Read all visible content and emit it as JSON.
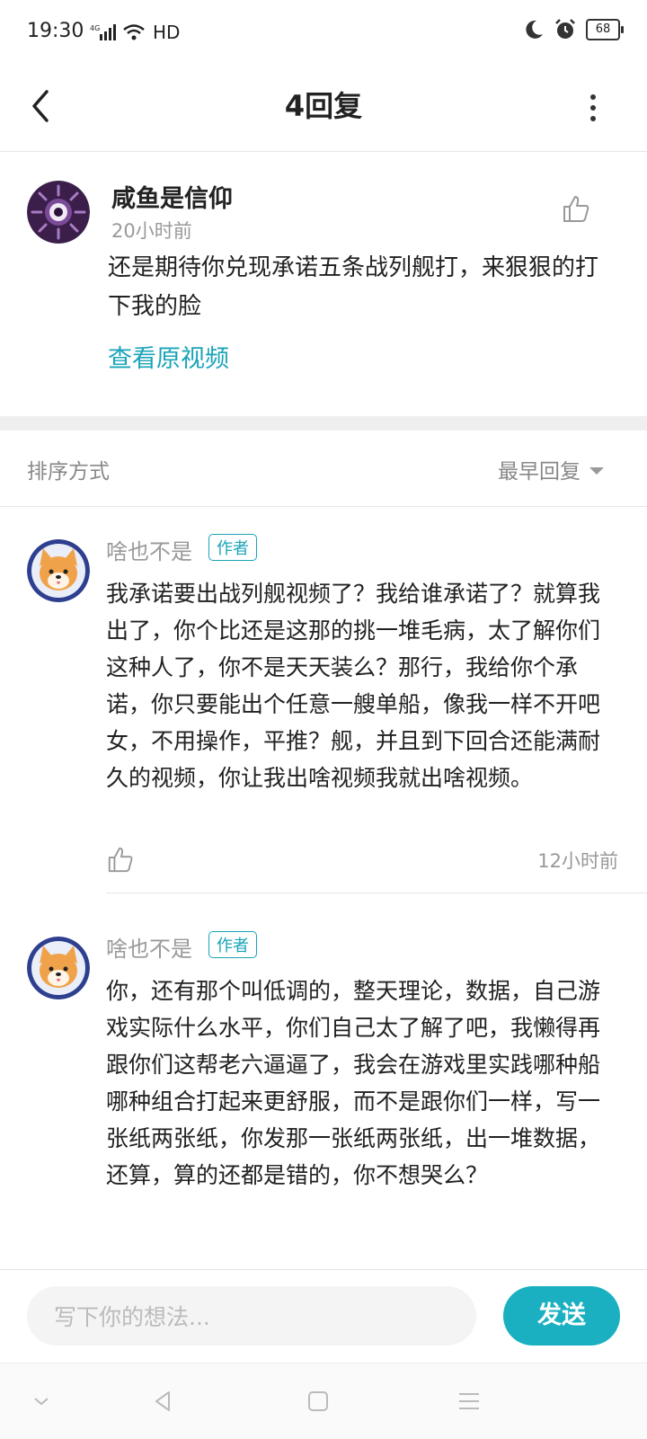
{
  "status_bar": {
    "time": "19:30",
    "network": "4G",
    "hd": "HD",
    "battery": "68",
    "icons": [
      "signal-icon",
      "wifi-icon",
      "moon-icon",
      "alarm-icon",
      "battery-icon"
    ]
  },
  "header": {
    "title": "4回复",
    "back_icon": "back-arrow-icon",
    "more_icon": "more-vertical-icon"
  },
  "post": {
    "author": "咸鱼是信仰",
    "time": "20小时前",
    "text": "还是期待你兑现承诺五条战列舰打，来狠狠的打下我的脸",
    "link": "查看原视频",
    "avatar_icon": "eye-avatar-icon",
    "like_icon": "thumbs-up-icon"
  },
  "sort": {
    "label": "排序方式",
    "value": "最早回复"
  },
  "replies": [
    {
      "author": "啥也不是",
      "badge": "作者",
      "text": "我承诺要出战列舰视频了？我给谁承诺了？就算我出了，你个比还是这那的挑一堆毛病，太了解你们这种人了，你不是天天装么？那行，我给你个承诺，你只要能出个任意一艘单船，像我一样不开吧女，不用操作，平推？舰，并且到下回合还能满耐久的视频，你让我出啥视频我就出啥视频。",
      "time": "12小时前"
    },
    {
      "author": "啥也不是",
      "badge": "作者",
      "text": "你，还有那个叫低调的，整天理论，数据，自己游戏实际什么水平，你们自己太了解了吧，我懒得再跟你们这帮老六逼逼了，我会在游戏里实践哪种船哪种组合打起来更舒服，而不是跟你们一样，写一张纸两张纸，你发那一张纸两张纸，出一堆数据，还算，算的还都是错的，你不想哭么？",
      "time": ""
    }
  ],
  "composer": {
    "placeholder": "写下你的想法...",
    "send_label": "发送"
  },
  "colors": {
    "accent": "#1ab0c1",
    "link": "#1aa4b8"
  }
}
